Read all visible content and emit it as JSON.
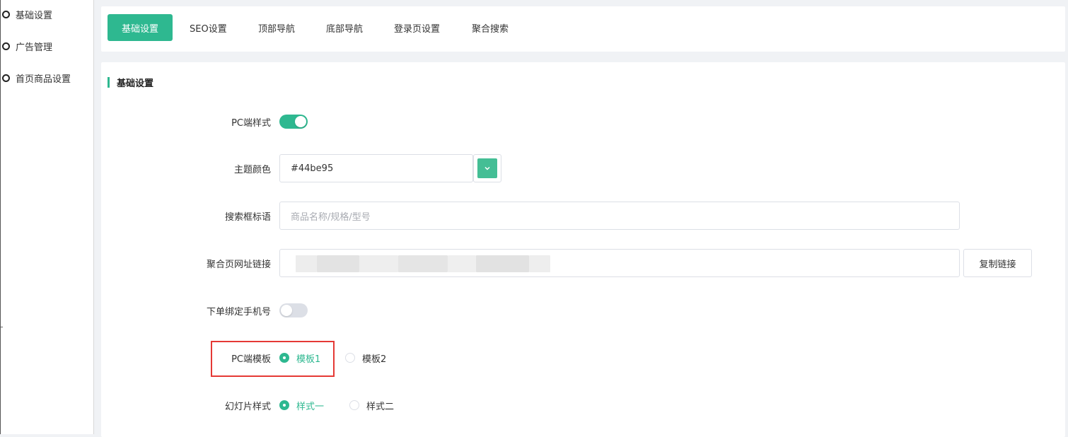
{
  "sidebar": {
    "items": [
      {
        "label": "基础设置"
      },
      {
        "label": "广告管理"
      },
      {
        "label": "首页商品设置"
      }
    ]
  },
  "tabs": [
    {
      "label": "基础设置",
      "active": true
    },
    {
      "label": "SEO设置",
      "active": false
    },
    {
      "label": "顶部导航",
      "active": false
    },
    {
      "label": "底部导航",
      "active": false
    },
    {
      "label": "登录页设置",
      "active": false
    },
    {
      "label": "聚合搜索",
      "active": false
    }
  ],
  "section": {
    "title": "基础设置"
  },
  "form": {
    "pc_style": {
      "label": "PC端样式",
      "enabled": true
    },
    "theme_color": {
      "label": "主题颜色",
      "value": "#44be95",
      "swatch": "#44be95",
      "icon": "chevron-down-icon"
    },
    "search_slogan": {
      "label": "搜索框标语",
      "placeholder": "商品名称/规格/型号"
    },
    "aggregate_link": {
      "label": "聚合页网址链接",
      "copy_button": "复制链接"
    },
    "bind_phone": {
      "label": "下单绑定手机号",
      "enabled": false
    },
    "pc_template": {
      "label": "PC端模板",
      "options": [
        {
          "label": "模板1",
          "checked": true
        },
        {
          "label": "模板2",
          "checked": false
        }
      ]
    },
    "slideshow_style": {
      "label": "幻灯片样式",
      "options": [
        {
          "label": "样式一",
          "checked": true
        },
        {
          "label": "样式二",
          "checked": false
        }
      ]
    }
  },
  "colors": {
    "accent": "#2eb890",
    "highlight": "#e53935"
  }
}
